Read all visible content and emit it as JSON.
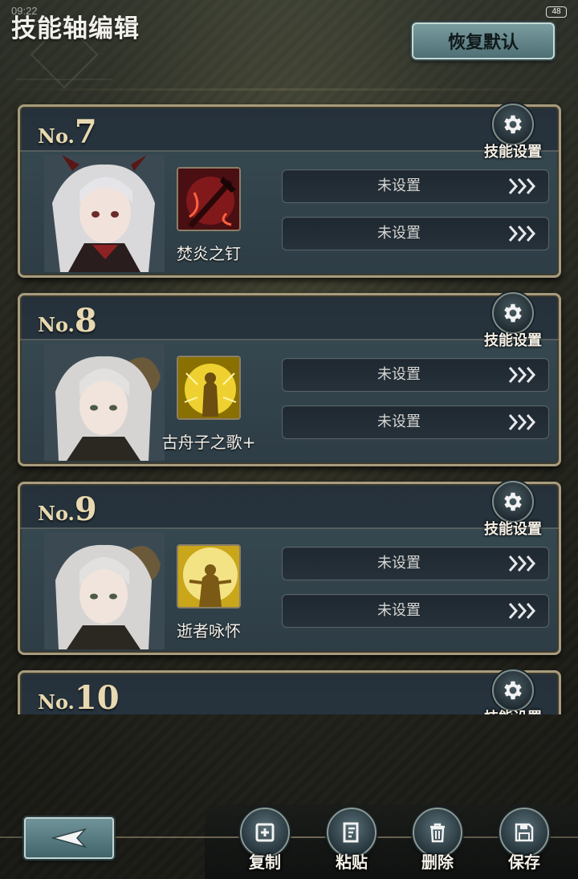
{
  "status": {
    "time": "09:22",
    "battery": "48"
  },
  "header": {
    "title": "技能轴编辑",
    "reset_label": "恢复默认"
  },
  "cards": [
    {
      "prefix": "No.",
      "number": "7",
      "settings_label": "技能设置",
      "skill_name": "焚炎之钉",
      "slots": [
        "未设置",
        "未设置"
      ]
    },
    {
      "prefix": "No.",
      "number": "8",
      "settings_label": "技能设置",
      "skill_name": "古舟子之歌+",
      "slots": [
        "未设置",
        "未设置"
      ]
    },
    {
      "prefix": "No.",
      "number": "9",
      "settings_label": "技能设置",
      "skill_name": "逝者咏怀",
      "slots": [
        "未设置",
        "未设置"
      ]
    },
    {
      "prefix": "No.",
      "number": "10",
      "settings_label": "技能设置"
    }
  ],
  "toolbar": {
    "copy": "复制",
    "paste": "粘贴",
    "delete": "删除",
    "save": "保存"
  },
  "colors": {
    "accent_teal": "#5f8489",
    "frame_gold": "#a89c7e",
    "card_bg": "#2e3d45"
  }
}
